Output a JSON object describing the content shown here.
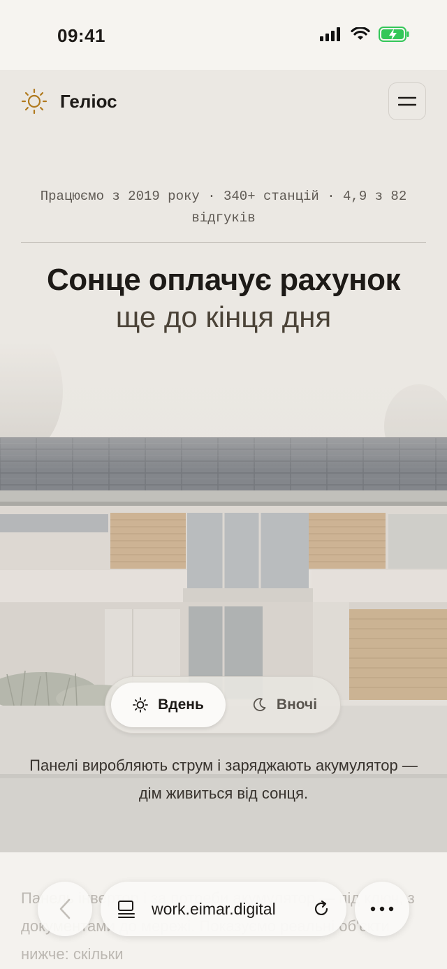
{
  "status_bar": {
    "time": "09:41"
  },
  "header": {
    "brand_name": "Геліос"
  },
  "hero": {
    "meta_line": "Працюємо з 2019 року · 340+ станцій · 4,9 з 82 відгуків",
    "headline_bold": "Сонце оплачує рахунок",
    "headline_regular": "ще до кінця дня",
    "mode_toggle": {
      "day_label": "Вдень",
      "night_label": "Вночі",
      "selected": "Вдень"
    },
    "caption": "Панелі виробляють струм і заряджають акумулятор — дім живиться від сонця."
  },
  "body": {
    "paragraph": "Панель інвертор і за потреби акумулятор — під ключ, з документами до мережі. Показуємо реальні об'єкти нижче: скільки"
  },
  "browser": {
    "url": "work.eimar.digital"
  },
  "colors": {
    "accent_sun": "#b07a1e",
    "battery_green": "#34c759"
  }
}
